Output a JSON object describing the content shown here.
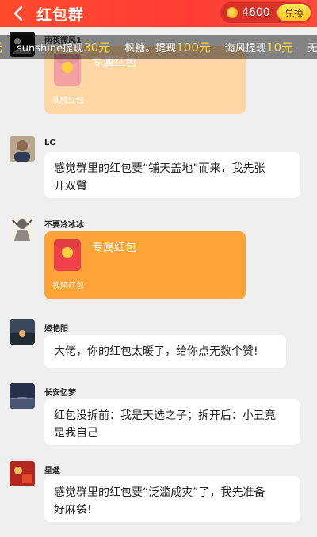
{
  "header": {
    "title": "红包群",
    "coin_amount": "4600",
    "exchange_label": "兑换"
  },
  "ticker": {
    "items": [
      {
        "prefix": "元",
        "name": "",
        "amount": ""
      },
      {
        "prefix": "",
        "name": "sunshine提现",
        "amount": "30元"
      },
      {
        "prefix": "",
        "name": "枫糖。提现",
        "amount": "100元"
      },
      {
        "prefix": "",
        "name": "海风提现",
        "amount": "10元"
      },
      {
        "prefix": "",
        "name": "无忧无",
        "amount": ""
      }
    ]
  },
  "messages": [
    {
      "name": "雨夜微风1",
      "type": "redpack",
      "title": "专属红包",
      "sub": "视频红包"
    },
    {
      "name": "LC",
      "type": "text",
      "text_line1": "感觉群里的红包要“铺天盖地”而来，我先张",
      "text_line2": "开双臂"
    },
    {
      "name": "不要冷冰冰",
      "type": "redpack",
      "title": "专属红包",
      "sub": "视频红包"
    },
    {
      "name": "姬艳阳",
      "type": "text",
      "text_line1": "大佬，你的红包太暖了，给你点无数个赞!"
    },
    {
      "name": "长安忆梦",
      "type": "text",
      "text_line1": "红包没拆前：我是天选之子；拆开后：小丑竟",
      "text_line2": "是我自己"
    },
    {
      "name": "星遥",
      "type": "text",
      "text_line1": "感觉群里的红包要“泛滥成灾”了，我先准备",
      "text_line2": "好麻袋!"
    }
  ],
  "colors": {
    "header_red": "#ff3d36",
    "redpack_orange": "#ffa337",
    "ticker_amount": "#ffd83a"
  }
}
